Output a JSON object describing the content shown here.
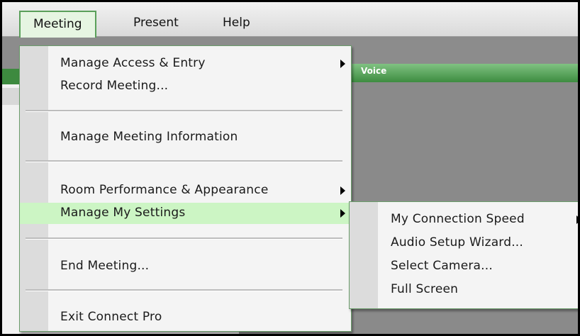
{
  "menubar": {
    "items": [
      {
        "label": "Meeting"
      },
      {
        "label": "Present"
      },
      {
        "label": "Help"
      }
    ]
  },
  "background": {
    "right_panel_title": "Voice"
  },
  "meeting_menu": {
    "items": [
      {
        "label": "Manage Access & Entry",
        "submenu": true
      },
      {
        "label": "Record Meeting..."
      },
      {
        "label": "Manage Meeting Information"
      },
      {
        "label": "Room Performance & Appearance",
        "submenu": true
      },
      {
        "label": "Manage My Settings",
        "submenu": true,
        "highlighted": true
      },
      {
        "label": "End Meeting..."
      },
      {
        "label": "Exit Connect Pro"
      }
    ]
  },
  "settings_submenu": {
    "items": [
      {
        "label": "My Connection Speed",
        "submenu": true
      },
      {
        "label": "Audio Setup Wizard..."
      },
      {
        "label": "Select Camera..."
      },
      {
        "label": "Full Screen"
      }
    ]
  },
  "colors": {
    "highlight": "#ccf5c4",
    "accent_green": "#3d8c40",
    "menu_bg": "#f4f4f4"
  }
}
